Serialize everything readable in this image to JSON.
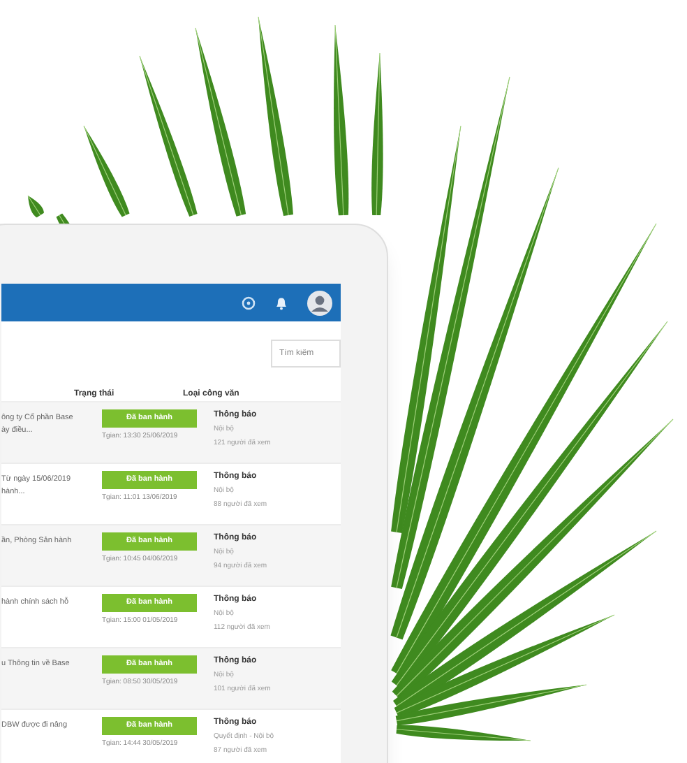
{
  "search": {
    "placeholder": "Tìm kiếm"
  },
  "table": {
    "columns": [
      "Trạng thái",
      "Loại công văn"
    ],
    "rows": [
      {
        "summary": [
          "ông ty Cổ phần Base",
          "ày điều..."
        ],
        "status": "Đã ban hành",
        "time": "Tgian: 13:30 25/06/2019",
        "type": "Thông báo",
        "scope": "Nội bộ",
        "views": "121 người đã xem"
      },
      {
        "summary": [
          "Từ ngày 15/06/2019",
          "hành..."
        ],
        "status": "Đã ban hành",
        "time": "Tgian: 11:01 13/06/2019",
        "type": "Thông báo",
        "scope": "Nội bộ",
        "views": "88 người đã xem"
      },
      {
        "summary": [
          "ần, Phòng Sản hành"
        ],
        "status": "Đã ban hành",
        "time": "Tgian: 10:45 04/06/2019",
        "type": "Thông báo",
        "scope": "Nội bộ",
        "views": "94 người đã xem"
      },
      {
        "summary": [
          "hành chính sách hỗ"
        ],
        "status": "Đã ban hành",
        "time": "Tgian: 15:00 01/05/2019",
        "type": "Thông báo",
        "scope": "Nội bộ",
        "views": "112 người đã xem"
      },
      {
        "summary": [
          "u Thông tin về Base"
        ],
        "status": "Đã ban hành",
        "time": "Tgian: 08:50 30/05/2019",
        "type": "Thông báo",
        "scope": "Nội bộ",
        "views": "101 người đã xem"
      },
      {
        "summary": [
          "DBW được đi nâng"
        ],
        "status": "Đã ban hành",
        "time": "Tgian: 14:44 30/05/2019",
        "type": "Thông báo",
        "scope": "Quyết định - Nội bộ",
        "views": "87 người đã xem"
      }
    ]
  }
}
